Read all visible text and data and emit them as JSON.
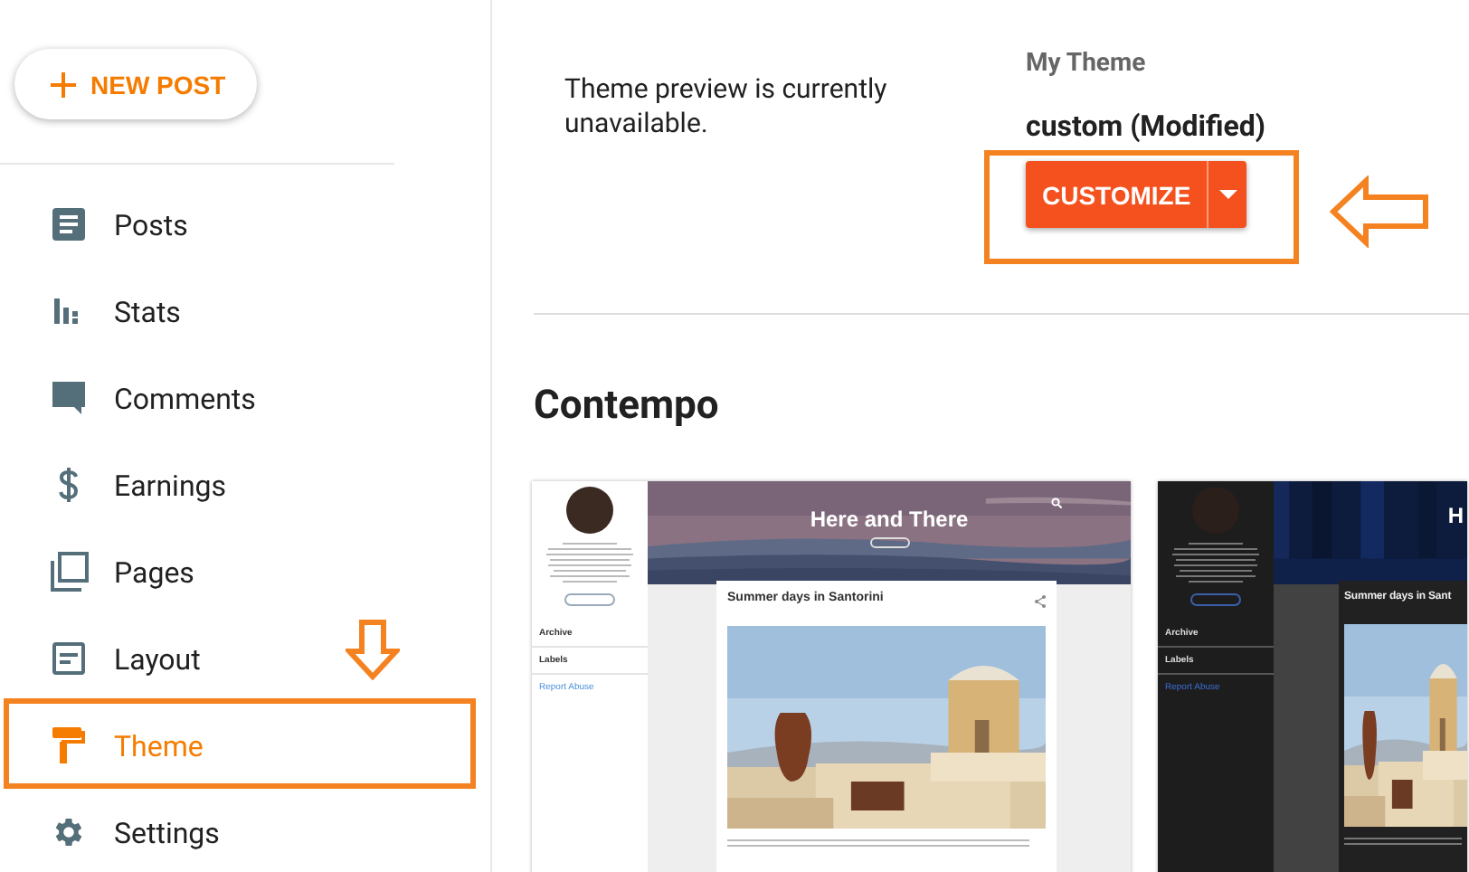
{
  "new_post_button": {
    "label": "NEW POST"
  },
  "nav": [
    {
      "kind": "posts",
      "label": "Posts",
      "selected": false,
      "annotated": false
    },
    {
      "kind": "stats",
      "label": "Stats",
      "selected": false,
      "annotated": false
    },
    {
      "kind": "comments",
      "label": "Comments",
      "selected": false,
      "annotated": false
    },
    {
      "kind": "earnings",
      "label": "Earnings",
      "selected": false,
      "annotated": false
    },
    {
      "kind": "pages",
      "label": "Pages",
      "selected": false,
      "annotated": false
    },
    {
      "kind": "layout",
      "label": "Layout",
      "selected": false,
      "annotated": false
    },
    {
      "kind": "theme",
      "label": "Theme",
      "selected": true,
      "annotated": true
    },
    {
      "kind": "settings",
      "label": "Settings",
      "selected": false,
      "annotated": false
    }
  ],
  "preview_message": "Theme preview is currently unavailable.",
  "my_theme": {
    "heading": "My Theme",
    "name": "custom (Modified)",
    "button": "CUSTOMIZE",
    "annotated": true
  },
  "theme_group": {
    "title": "Contempo"
  },
  "previews": [
    {
      "kind": "light",
      "blog_title": "Here and There",
      "post_title": "Summer days in Santorini",
      "sidebar_links": [
        "Archive",
        "Labels"
      ],
      "report_link": "Report Abuse"
    },
    {
      "kind": "dark",
      "blog_title": "H",
      "post_title": "Summer days in Sant",
      "sidebar_links": [
        "Archive",
        "Labels"
      ],
      "report_link": "Report Abuse"
    }
  ]
}
